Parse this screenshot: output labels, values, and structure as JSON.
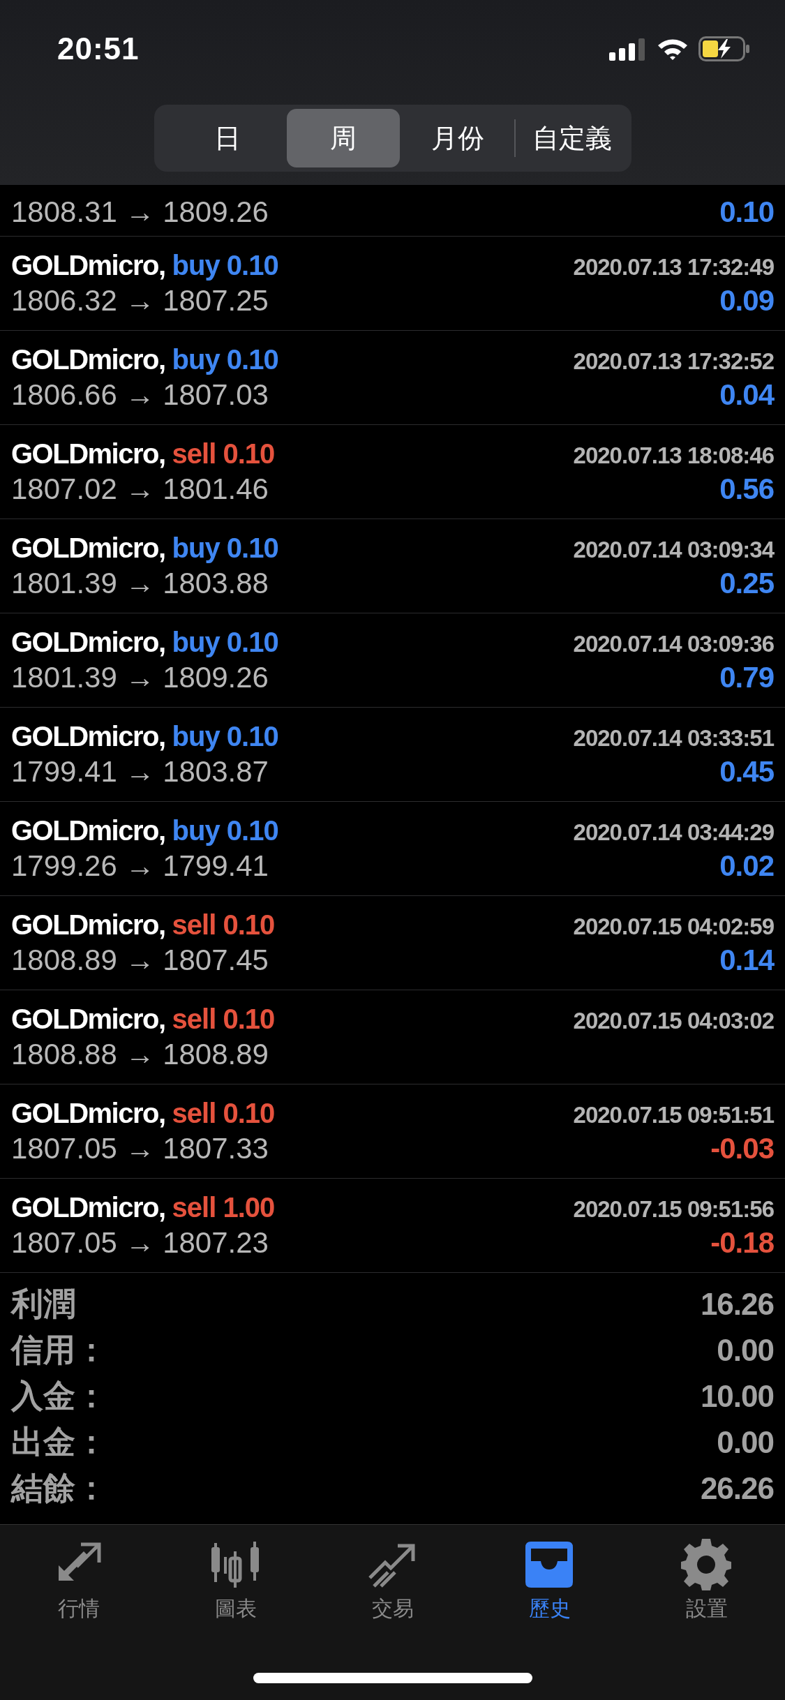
{
  "status_bar": {
    "time": "20:51"
  },
  "period_tabs": [
    {
      "label": "日",
      "selected": false
    },
    {
      "label": "周",
      "selected": true
    },
    {
      "label": "月份",
      "selected": false
    },
    {
      "label": "自定義",
      "selected": false
    }
  ],
  "trades": [
    {
      "prices": "1808.31 → 1809.26",
      "profit": "0.10",
      "loss": false
    },
    {
      "symbol": "GOLDmicro,",
      "side": "buy 0.10",
      "kind": "buy",
      "time": "2020.07.13 17:32:49",
      "prices": "1806.32 → 1807.25",
      "profit": "0.09",
      "loss": false
    },
    {
      "symbol": "GOLDmicro,",
      "side": "buy 0.10",
      "kind": "buy",
      "time": "2020.07.13 17:32:52",
      "prices": "1806.66 → 1807.03",
      "profit": "0.04",
      "loss": false
    },
    {
      "symbol": "GOLDmicro,",
      "side": "sell 0.10",
      "kind": "sell",
      "time": "2020.07.13 18:08:46",
      "prices": "1807.02 → 1801.46",
      "profit": "0.56",
      "loss": false
    },
    {
      "symbol": "GOLDmicro,",
      "side": "buy 0.10",
      "kind": "buy",
      "time": "2020.07.14 03:09:34",
      "prices": "1801.39 → 1803.88",
      "profit": "0.25",
      "loss": false
    },
    {
      "symbol": "GOLDmicro,",
      "side": "buy 0.10",
      "kind": "buy",
      "time": "2020.07.14 03:09:36",
      "prices": "1801.39 → 1809.26",
      "profit": "0.79",
      "loss": false
    },
    {
      "symbol": "GOLDmicro,",
      "side": "buy 0.10",
      "kind": "buy",
      "time": "2020.07.14 03:33:51",
      "prices": "1799.41 → 1803.87",
      "profit": "0.45",
      "loss": false
    },
    {
      "symbol": "GOLDmicro,",
      "side": "buy 0.10",
      "kind": "buy",
      "time": "2020.07.14 03:44:29",
      "prices": "1799.26 → 1799.41",
      "profit": "0.02",
      "loss": false
    },
    {
      "symbol": "GOLDmicro,",
      "side": "sell 0.10",
      "kind": "sell",
      "time": "2020.07.15 04:02:59",
      "prices": "1808.89 → 1807.45",
      "profit": "0.14",
      "loss": false
    },
    {
      "symbol": "GOLDmicro,",
      "side": "sell 0.10",
      "kind": "sell",
      "time": "2020.07.15 04:03:02",
      "prices": "1808.88 → 1808.89"
    },
    {
      "symbol": "GOLDmicro,",
      "side": "sell 0.10",
      "kind": "sell",
      "time": "2020.07.15 09:51:51",
      "prices": "1807.05 → 1807.33",
      "profit": "-0.03",
      "loss": true
    },
    {
      "symbol": "GOLDmicro,",
      "side": "sell 1.00",
      "kind": "sell",
      "time": "2020.07.15 09:51:56",
      "prices": "1807.05 → 1807.23",
      "profit": "-0.18",
      "loss": true
    }
  ],
  "summary": [
    {
      "label": "利潤",
      "value": "16.26"
    },
    {
      "label": "信用：",
      "value": "0.00"
    },
    {
      "label": "入金：",
      "value": "10.00"
    },
    {
      "label": "出金：",
      "value": "0.00"
    },
    {
      "label": "結餘：",
      "value": "26.26"
    }
  ],
  "tab_bar": [
    {
      "label": "行情",
      "kind": "quotes",
      "selected": false
    },
    {
      "label": "圖表",
      "kind": "chart",
      "selected": false
    },
    {
      "label": "交易",
      "kind": "trade",
      "selected": false
    },
    {
      "label": "歷史",
      "kind": "history",
      "selected": true
    },
    {
      "label": "設置",
      "kind": "settings",
      "selected": false
    }
  ]
}
